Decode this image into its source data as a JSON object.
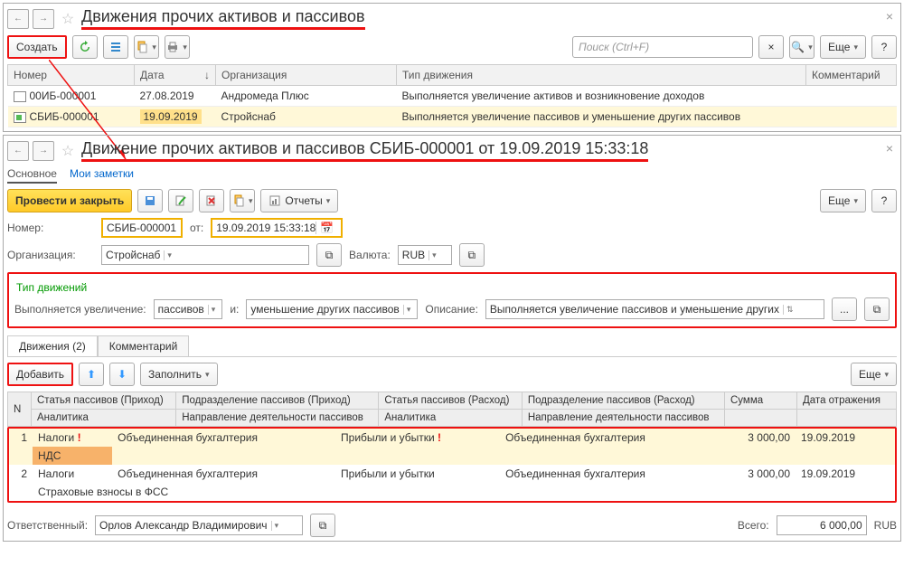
{
  "top": {
    "title": "Движения прочих активов и пассивов",
    "create_label": "Создать",
    "search_placeholder": "Поиск (Ctrl+F)",
    "more_label": "Еще",
    "cols": {
      "num": "Номер",
      "date": "Дата",
      "org": "Организация",
      "type": "Тип движения",
      "comment": "Комментарий"
    },
    "rows": [
      {
        "num": "00ИБ-000001",
        "date": "27.08.2019",
        "org": "Андромеда Плюс",
        "type": "Выполняется увеличение активов и возникновение доходов"
      },
      {
        "num": "СБИБ-000001",
        "date": "19.09.2019",
        "org": "Стройснаб",
        "type": "Выполняется увеличение пассивов и уменьшение других пассивов"
      }
    ]
  },
  "doc": {
    "title": "Движение прочих активов и пассивов СБИБ-000001 от 19.09.2019 15:33:18",
    "nav_main": "Основное",
    "nav_notes": "Мои заметки",
    "post_close": "Провести и закрыть",
    "reports": "Отчеты",
    "more_label": "Еще",
    "num_lbl": "Номер:",
    "num_val": "СБИБ-000001",
    "from_lbl": "от:",
    "date_val": "19.09.2019 15:33:18",
    "org_lbl": "Организация:",
    "org_val": "Стройснаб",
    "cur_lbl": "Валюта:",
    "cur_val": "RUB",
    "mv_head": "Тип движений",
    "inc_lbl": "Выполняется увеличение:",
    "inc_val": "пассивов",
    "and_lbl": "и:",
    "dec_val": "уменьшение других пассивов",
    "desc_lbl": "Описание:",
    "desc_val": "Выполняется увеличение пассивов и уменьшение других",
    "tab_moves": "Движения (2)",
    "tab_comment": "Комментарий",
    "add_label": "Добавить",
    "fill_label": "Заполнить",
    "cols": {
      "n": "N",
      "art_in": "Статья пассивов (Приход)",
      "dept_in": "Подразделение пассивов (Приход)",
      "art_out": "Статья пассивов (Расход)",
      "dept_out": "Подразделение пассивов (Расход)",
      "sum": "Сумма",
      "refl": "Дата отражения",
      "anal": "Аналитика",
      "dir": "Направление деятельности пассивов"
    },
    "rows": [
      {
        "n": "1",
        "art_in": "Налоги",
        "dept_in": "Объединенная бухгалтерия",
        "art_out": "Прибыли и убытки",
        "dept_out": "Объединенная бухгалтерия",
        "sum": "3 000,00",
        "refl": "19.09.2019",
        "anal": "НДС",
        "warn": true
      },
      {
        "n": "2",
        "art_in": "Налоги",
        "dept_in": "Объединенная бухгалтерия",
        "art_out": "Прибыли и убытки",
        "dept_out": "Объединенная бухгалтерия",
        "sum": "3 000,00",
        "refl": "19.09.2019",
        "anal": "Страховые взносы в ФСС",
        "warn": false
      }
    ],
    "resp_lbl": "Ответственный:",
    "resp_val": "Орлов Александр Владимирович",
    "total_lbl": "Всего:",
    "total_val": "6 000,00",
    "total_cur": "RUB"
  }
}
